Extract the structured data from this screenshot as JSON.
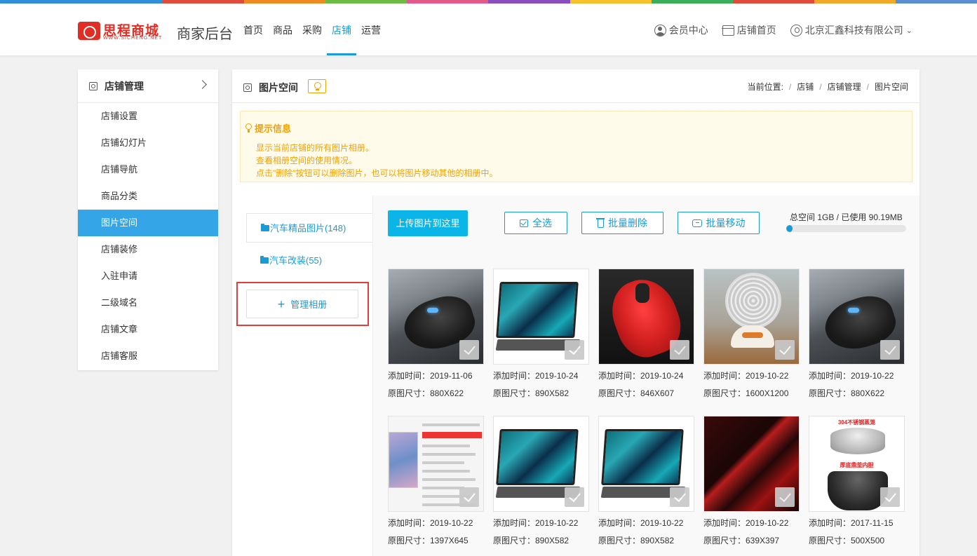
{
  "colors": {
    "accent": "#1a9bd6",
    "active_side": "#34a6e8",
    "upload": "#0bb5e8",
    "tip_text": "#f2a100",
    "highlight_box": "#e23c3c"
  },
  "top_stripe": [
    "#2f8fd8",
    "#2f8fd8",
    "#e14b3b",
    "#f08a24",
    "#6dbd45",
    "#e25a8a",
    "#8a4fbf",
    "#f6c12b",
    "#3aae5a",
    "#e14b3b",
    "#f3a928",
    "#5b8fd1"
  ],
  "header": {
    "logo_text": "思程商城",
    "logo_sub": "WWW.SICHENG.NET",
    "app_title": "商家后台",
    "nav": [
      {
        "label": "首页",
        "active": false
      },
      {
        "label": "商品",
        "active": false
      },
      {
        "label": "采购",
        "active": false
      },
      {
        "label": "店铺",
        "active": true
      },
      {
        "label": "运营",
        "active": false
      }
    ],
    "right": {
      "member_center": "会员中心",
      "store_home": "店铺首页",
      "company": "北京汇鑫科技有限公司"
    }
  },
  "sidebar": {
    "title": "店铺管理",
    "items": [
      {
        "label": "店铺设置"
      },
      {
        "label": "店铺幻灯片"
      },
      {
        "label": "店铺导航"
      },
      {
        "label": "商品分类"
      },
      {
        "label": "图片空间",
        "active": true
      },
      {
        "label": "店铺装修"
      },
      {
        "label": "入驻申请"
      },
      {
        "label": "二级域名"
      },
      {
        "label": "店铺文章"
      },
      {
        "label": "店铺客服"
      }
    ]
  },
  "main": {
    "title": "图片空间",
    "breadcrumb": {
      "prefix": "当前位置:",
      "items": [
        "店铺",
        "店铺管理",
        "图片空间"
      ]
    },
    "tips": {
      "title": "提示信息",
      "lines": [
        "显示当前店铺的所有图片相册。",
        "查看相册空间的使用情况。",
        "点击\"删除\"按钮可以删除图片，也可以将图片移动其他的相册中。"
      ]
    },
    "albums": [
      {
        "label": "汽车精品图片(148)",
        "selected": true
      },
      {
        "label": "汽车改装(55)",
        "selected": false
      }
    ],
    "manage_album": "管理相册",
    "toolbar": {
      "upload": "上传图片到这里",
      "select_all": "全选",
      "batch_delete": "批量删除",
      "batch_move": "批量移动"
    },
    "space": {
      "label": "总空间 1GB / 已使用 90.19MB",
      "used_fraction": 0.05
    },
    "photos": [
      {
        "img": "mouse-black",
        "added": "添加时间：2019-11-06",
        "size": "原图尺寸：880X622"
      },
      {
        "img": "tablet",
        "added": "添加时间：2019-10-24",
        "size": "原图尺寸：890X582"
      },
      {
        "img": "mouse-red",
        "added": "添加时间：2019-10-24",
        "size": "原图尺寸：846X607"
      },
      {
        "img": "fan",
        "added": "添加时间：2019-10-22",
        "size": "原图尺寸：1600X1200"
      },
      {
        "img": "mouse-black",
        "added": "添加时间：2019-10-22",
        "size": "原图尺寸：880X622"
      },
      {
        "img": "screenshot",
        "added": "添加时间：2019-10-22",
        "size": "原图尺寸：1397X645"
      },
      {
        "img": "tablet",
        "added": "添加时间：2019-10-22",
        "size": "原图尺寸：890X582"
      },
      {
        "img": "tablet",
        "added": "添加时间：2019-10-22",
        "size": "原图尺寸：890X582"
      },
      {
        "img": "red-abstract",
        "added": "添加时间：2019-10-22",
        "size": "原图尺寸：639X397"
      },
      {
        "img": "rice-cooker",
        "added": "添加时间：2017-11-15",
        "size": "原图尺寸：500X500"
      }
    ],
    "cooker_text_top": "304不锈钢蒸笼",
    "cooker_text_mid": "厚底鼎釜内胆"
  }
}
